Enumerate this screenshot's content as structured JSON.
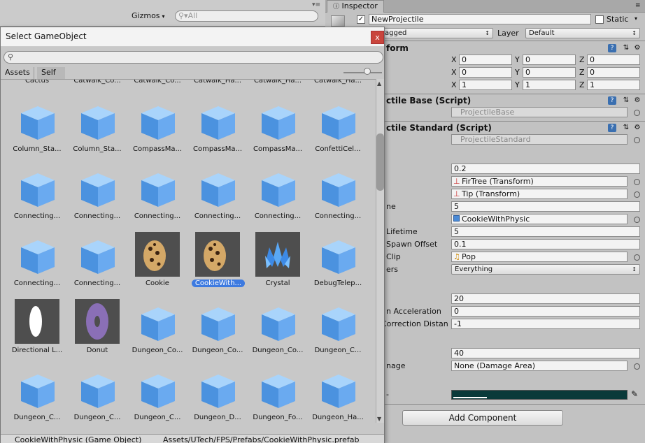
{
  "scene_toolbar": {
    "gizmos_label": "Gizmos",
    "search_placeholder": "All"
  },
  "picker": {
    "title": "Select GameObject",
    "close_label": "x",
    "search_value": "",
    "tabs": [
      "Assets",
      "Self"
    ],
    "partial_row": [
      "Cactus",
      "Catwalk_Co...",
      "Catwalk_Co...",
      "Catwalk_Ha...",
      "Catwalk_Ha...",
      "Catwalk_Ha..."
    ],
    "items": [
      {
        "name": "Column_Sta...",
        "kind": "cube"
      },
      {
        "name": "Column_Sta...",
        "kind": "cube"
      },
      {
        "name": "CompassMa...",
        "kind": "cube"
      },
      {
        "name": "CompassMa...",
        "kind": "cube"
      },
      {
        "name": "CompassMa...",
        "kind": "cube"
      },
      {
        "name": "ConfettiCel...",
        "kind": "cube"
      },
      {
        "name": "Connecting...",
        "kind": "cube"
      },
      {
        "name": "Connecting...",
        "kind": "cube"
      },
      {
        "name": "Connecting...",
        "kind": "cube"
      },
      {
        "name": "Connecting...",
        "kind": "cube"
      },
      {
        "name": "Connecting...",
        "kind": "cube"
      },
      {
        "name": "Connecting...",
        "kind": "cube"
      },
      {
        "name": "Connecting...",
        "kind": "cube"
      },
      {
        "name": "Connecting...",
        "kind": "cube"
      },
      {
        "name": "Cookie",
        "kind": "cookie"
      },
      {
        "name": "CookieWith...",
        "kind": "cookie",
        "selected": true
      },
      {
        "name": "Crystal",
        "kind": "crystal"
      },
      {
        "name": "DebugTelep...",
        "kind": "cube"
      },
      {
        "name": "Directional L...",
        "kind": "light"
      },
      {
        "name": "Donut",
        "kind": "donut"
      },
      {
        "name": "Dungeon_Co...",
        "kind": "cube"
      },
      {
        "name": "Dungeon_Co...",
        "kind": "cube"
      },
      {
        "name": "Dungeon_Co...",
        "kind": "cube"
      },
      {
        "name": "Dungeon_C...",
        "kind": "cube"
      },
      {
        "name": "Dungeon_C...",
        "kind": "cube"
      },
      {
        "name": "Dungeon_C...",
        "kind": "cube"
      },
      {
        "name": "Dungeon_C...",
        "kind": "cube"
      },
      {
        "name": "Dungeon_D...",
        "kind": "cube"
      },
      {
        "name": "Dungeon_Fo...",
        "kind": "cube"
      },
      {
        "name": "Dungeon_Ha...",
        "kind": "cube"
      }
    ],
    "status_name": "CookieWithPhysic (Game Object)",
    "status_path": "Assets/UTech/FPS/Prefabs/CookieWithPhysic.prefab"
  },
  "inspector": {
    "tab_label": "Inspector",
    "object_name": "NewProjectile",
    "static_label": "Static",
    "tag_value": "agged",
    "layer_label": "Layer",
    "layer_value": "Default",
    "transform": {
      "header": "form",
      "position": {
        "x": "0",
        "y": "0",
        "z": "0"
      },
      "rotation": {
        "x": "0",
        "y": "0",
        "z": "0"
      },
      "scale": {
        "x": "1",
        "y": "1",
        "z": "1"
      }
    },
    "base_header": "ctile Base (Script)",
    "base_script": "ProjectileBase",
    "std_header": "ctile Standard (Script)",
    "std_script": "ProjectileStandard",
    "fields": {
      "f1_value": "0.2",
      "f2_value": "FirTree (Transform)",
      "f3_value": "Tip (Transform)",
      "f4_label": "ne",
      "f4_value": "5",
      "f5_value": "CookieWithPhysic",
      "f6_label": "Lifetime",
      "f6_value": "5",
      "f7_label": "Spawn Offset",
      "f7_value": "0.1",
      "f8_label": "Clip",
      "f8_value": "Pop",
      "f9_label": "ers",
      "f9_value": "Everything",
      "f10_value": "20",
      "f11_label": "n Acceleration",
      "f11_value": "0",
      "f12_label": "Correction Distan",
      "f12_value": "-1",
      "f13_value": "40",
      "f14_label": "nage",
      "f14_value": "None (Damage Area)"
    },
    "add_component_label": "Add Component",
    "trail_color": "#0a3a3a"
  }
}
